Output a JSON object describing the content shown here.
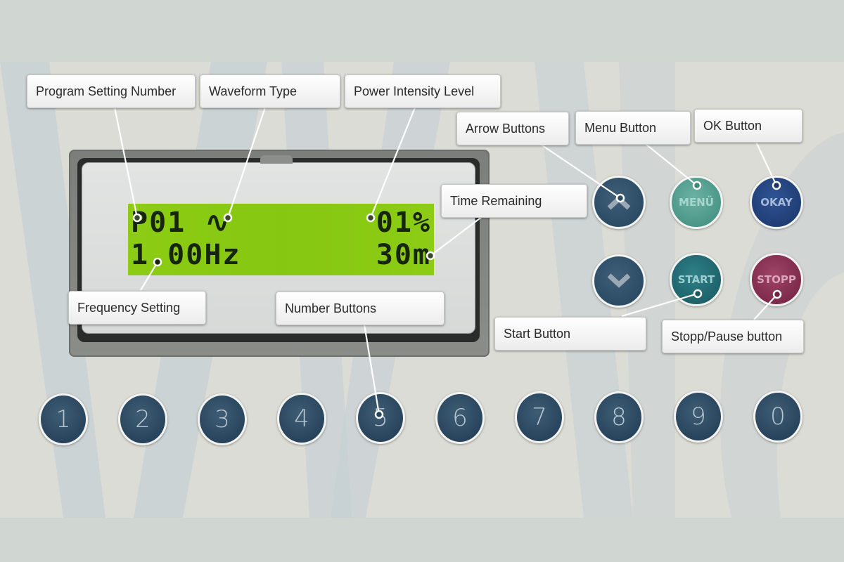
{
  "lcd": {
    "program": "P01",
    "waveform": "∿",
    "intensity": "01%",
    "frequency": "1.00Hz",
    "time_remaining": "30m"
  },
  "callouts": {
    "program_setting_number": "Program Setting Number",
    "waveform_type": "Waveform Type",
    "power_intensity_level": "Power Intensity Level",
    "arrow_buttons": "Arrow Buttons",
    "menu_button": "Menu Button",
    "ok_button": "OK Button",
    "time_remaining": "Time Remaining",
    "frequency_setting": "Frequency Setting",
    "number_buttons": "Number Buttons",
    "start_button": "Start Button",
    "stopp_pause_button": "Stopp/Pause button"
  },
  "buttons": {
    "menu": "MENÜ",
    "okay": "OKAY",
    "start": "START",
    "stopp": "STOPP",
    "up_icon": "chevron-up-icon",
    "down_icon": "chevron-down-icon",
    "numbers": [
      "1",
      "2",
      "3",
      "4",
      "5",
      "6",
      "7",
      "8",
      "9",
      "0"
    ]
  },
  "colors": {
    "lcd_green": "#8ccc14",
    "arrow_button": "#2f4d66",
    "menu_button": "#4f9a8c",
    "okay_button": "#1f3f7a",
    "start_button": "#1f6a70",
    "stopp_button": "#8a2c50",
    "number_button": "#28465e"
  }
}
